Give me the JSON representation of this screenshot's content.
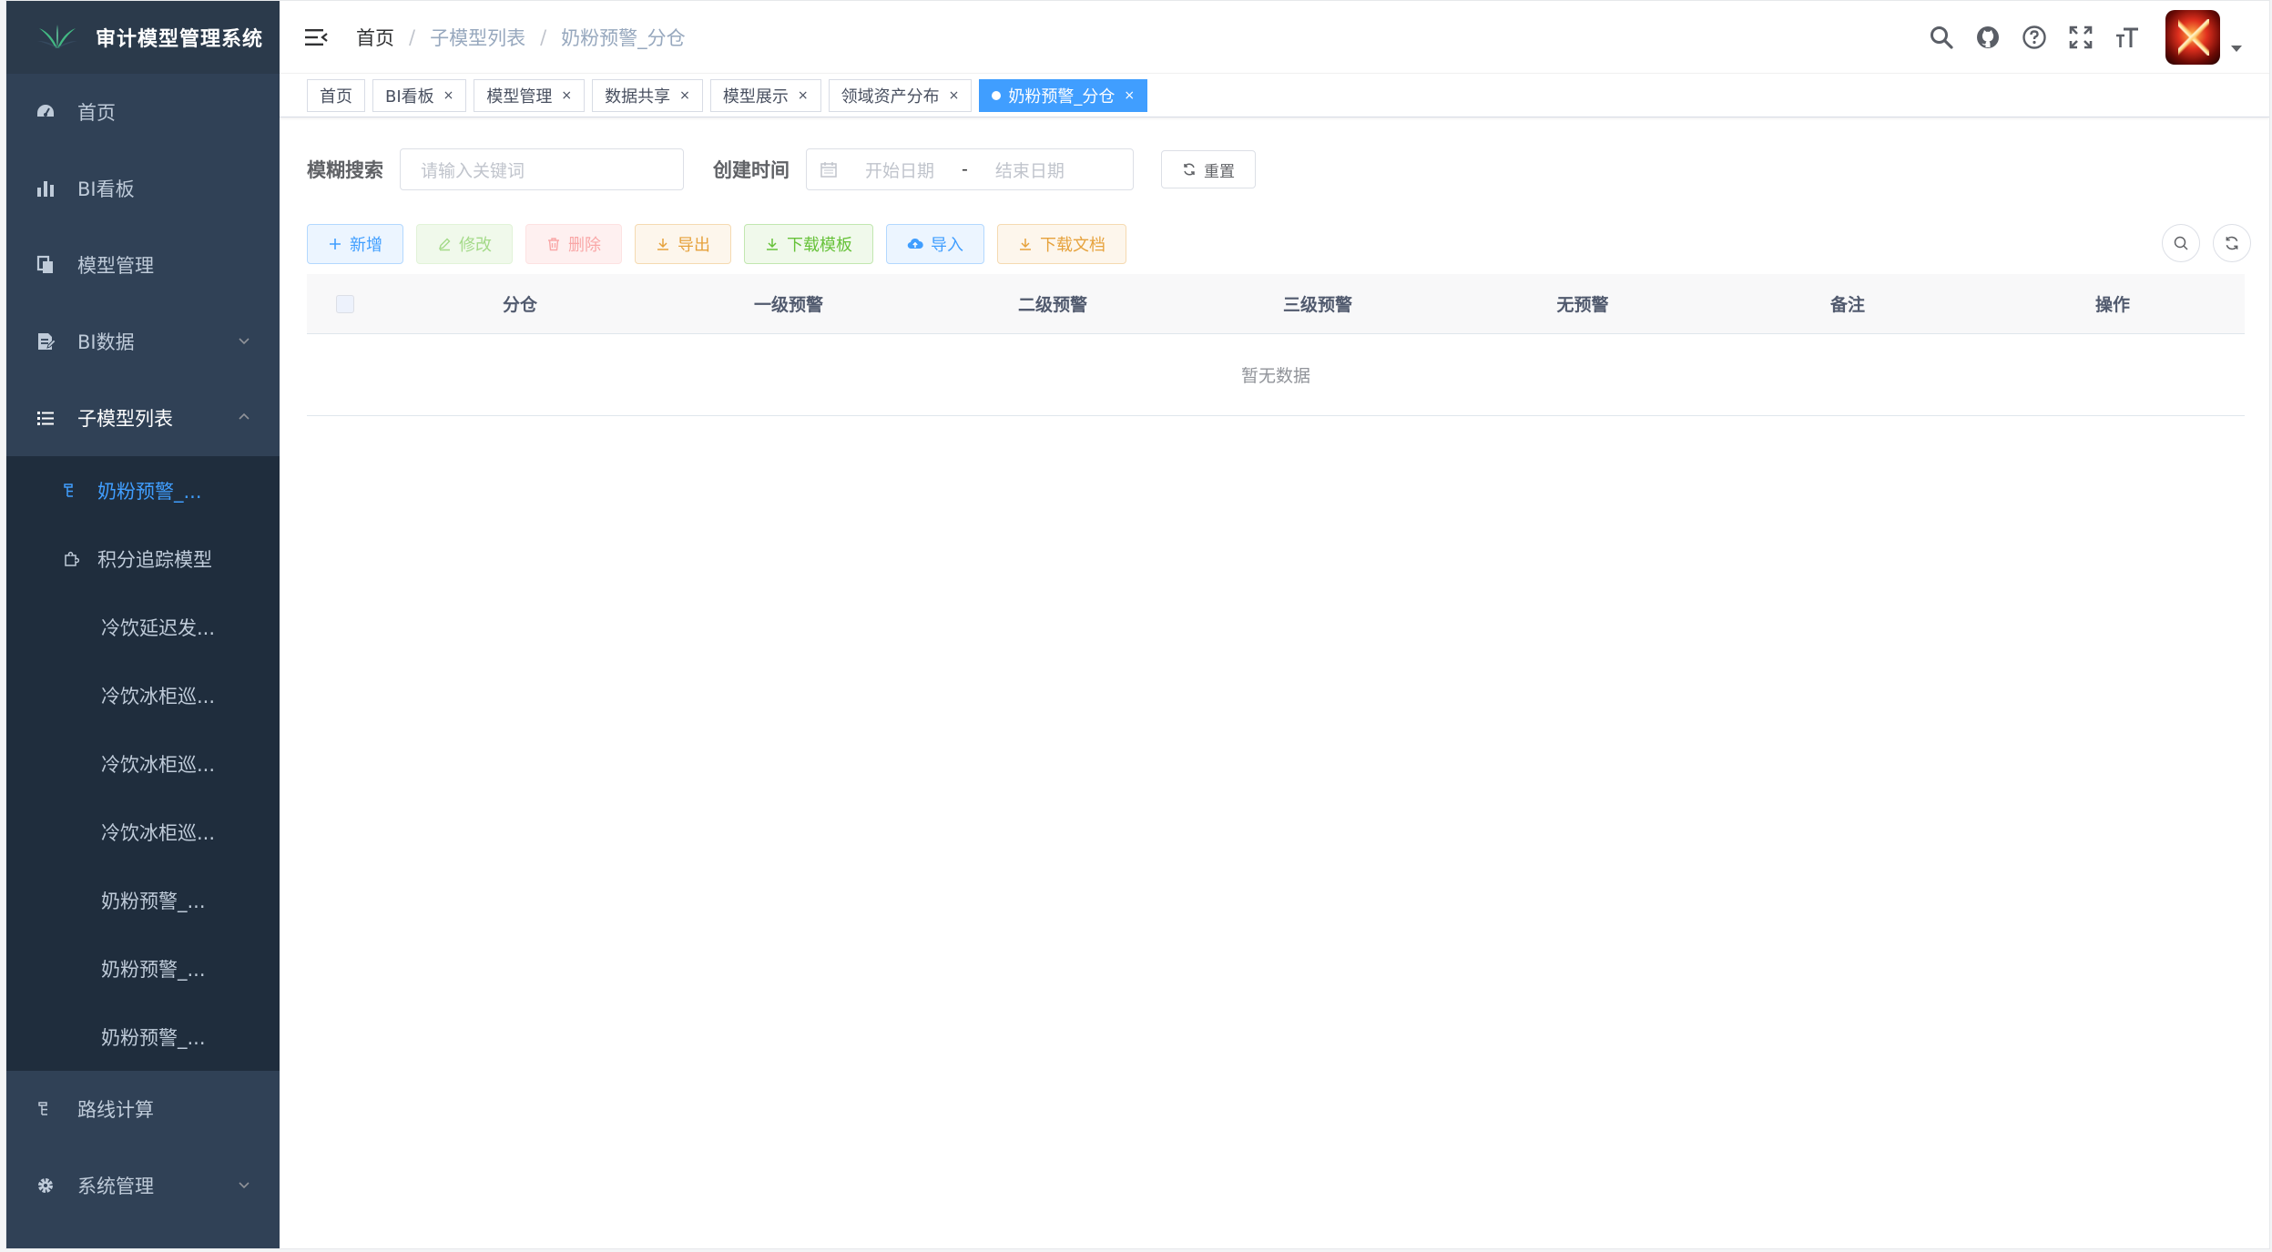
{
  "app": {
    "title": "审计模型管理系统"
  },
  "sidebar": {
    "items": [
      {
        "label": "首页",
        "icon": "dashboard-icon"
      },
      {
        "label": "BI看板",
        "icon": "bar-chart-icon"
      },
      {
        "label": "模型管理",
        "icon": "copy-document-icon"
      },
      {
        "label": "BI数据",
        "icon": "document-edit-icon",
        "expandable": true,
        "expanded": false
      },
      {
        "label": "子模型列表",
        "icon": "list-icon",
        "expandable": true,
        "expanded": true
      },
      {
        "label": "路线计算",
        "icon": "tree-icon"
      },
      {
        "label": "系统管理",
        "icon": "gear-icon",
        "expandable": true,
        "expanded": false
      }
    ],
    "submenu": [
      {
        "label": "奶粉预警_...",
        "icon": "tree-icon",
        "active": true
      },
      {
        "label": "积分追踪模型",
        "icon": "puzzle-icon"
      },
      {
        "label": "冷饮延迟发..."
      },
      {
        "label": "冷饮冰柜巡..."
      },
      {
        "label": "冷饮冰柜巡..."
      },
      {
        "label": "冷饮冰柜巡..."
      },
      {
        "label": "奶粉预警_..."
      },
      {
        "label": "奶粉预警_..."
      },
      {
        "label": "奶粉预警_..."
      }
    ]
  },
  "breadcrumb": [
    "首页",
    "子模型列表",
    "奶粉预警_分仓"
  ],
  "header_icons": [
    "search-icon",
    "github-icon",
    "help-icon",
    "fullscreen-icon",
    "font-size-icon"
  ],
  "tags": [
    {
      "label": "首页",
      "closable": false,
      "active": false
    },
    {
      "label": "BI看板",
      "closable": true,
      "active": false
    },
    {
      "label": "模型管理",
      "closable": true,
      "active": false
    },
    {
      "label": "数据共享",
      "closable": true,
      "active": false
    },
    {
      "label": "模型展示",
      "closable": true,
      "active": false
    },
    {
      "label": "领域资产分布",
      "closable": true,
      "active": false
    },
    {
      "label": "奶粉预警_分仓",
      "closable": true,
      "active": true
    }
  ],
  "search": {
    "keyword_label": "模糊搜索",
    "keyword_placeholder": "请输入关键词",
    "date_label": "创建时间",
    "start_placeholder": "开始日期",
    "range_separator": "-",
    "end_placeholder": "结束日期",
    "reset_label": "重置"
  },
  "toolbar": {
    "add": "新增",
    "edit": "修改",
    "delete": "删除",
    "export": "导出",
    "download_template": "下载模板",
    "import": "导入",
    "download_doc": "下载文档"
  },
  "table": {
    "columns": [
      "分仓",
      "一级预警",
      "二级预警",
      "三级预警",
      "无预警",
      "备注",
      "操作"
    ],
    "rows": [],
    "empty_text": "暂无数据"
  },
  "colors": {
    "sidebar_bg": "#304156",
    "submenu_bg": "#1f2d3d",
    "accent": "#409eff"
  }
}
